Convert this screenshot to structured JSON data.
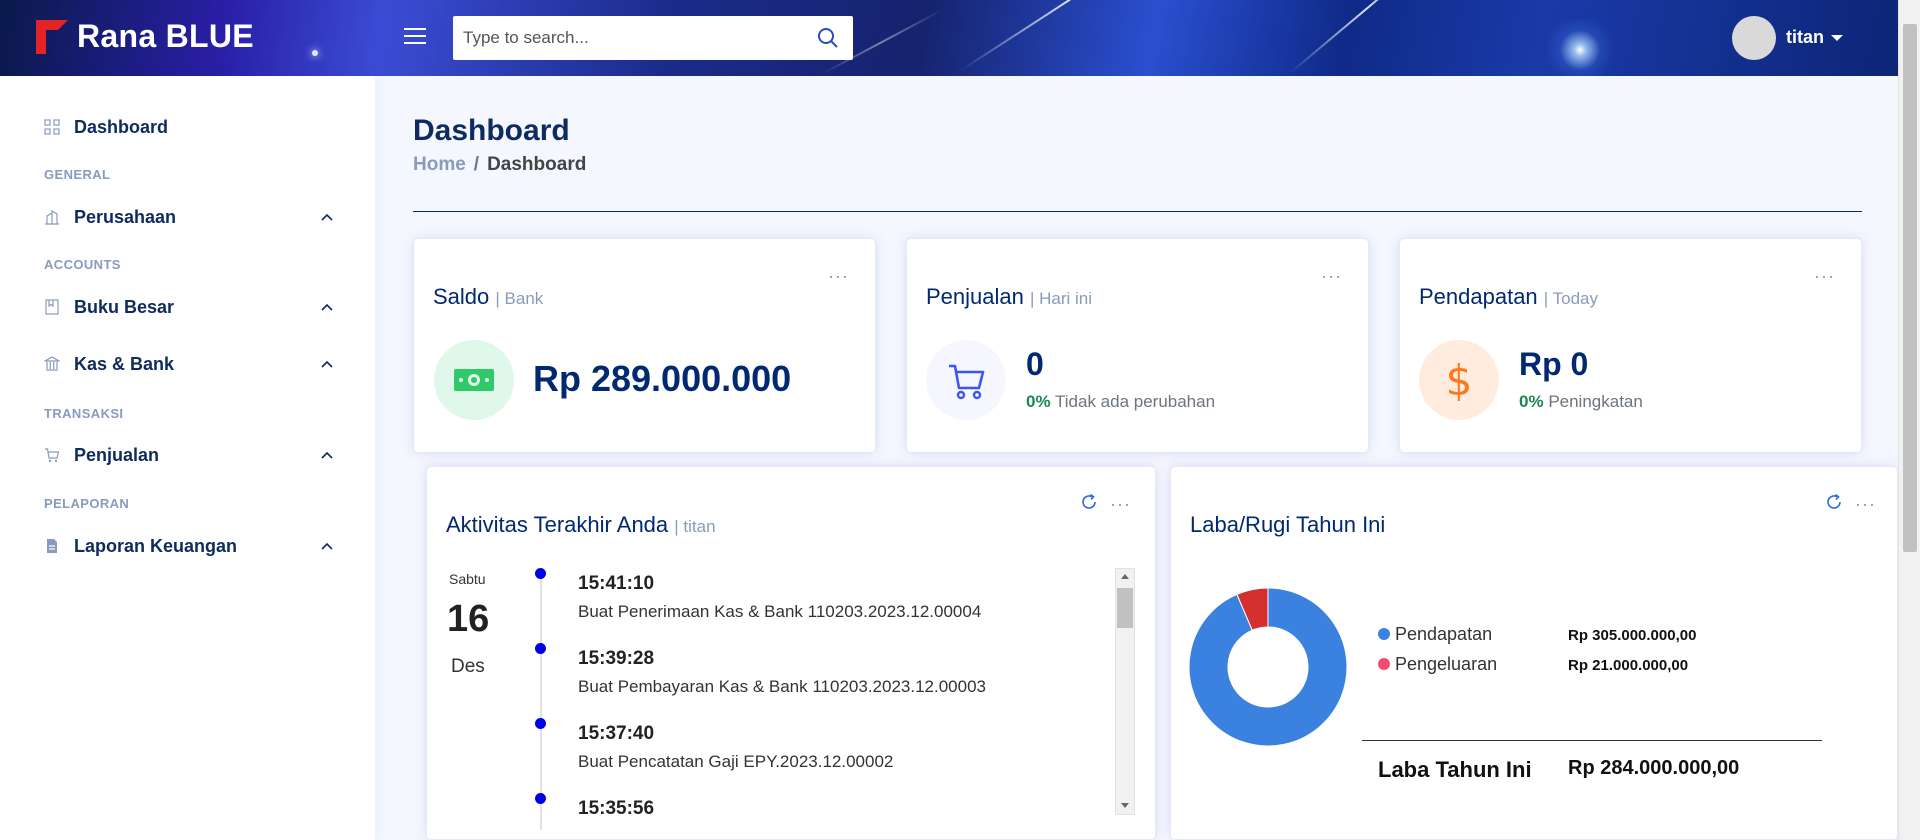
{
  "app": {
    "name": "Rana BLUE"
  },
  "header": {
    "search_placeholder": "Type to search...",
    "user_name": "titan"
  },
  "sidebar": {
    "dashboard_label": "Dashboard",
    "sections": [
      {
        "heading": "GENERAL",
        "items": [
          {
            "label": "Perusahaan",
            "icon": "building-icon"
          }
        ]
      },
      {
        "heading": "ACCOUNTS",
        "items": [
          {
            "label": "Buku Besar",
            "icon": "book-icon"
          },
          {
            "label": "Kas & Bank",
            "icon": "bank-icon"
          }
        ]
      },
      {
        "heading": "TRANSAKSI",
        "items": [
          {
            "label": "Penjualan",
            "icon": "cart-icon"
          }
        ]
      },
      {
        "heading": "PELAPORAN",
        "items": [
          {
            "label": "Laporan Keuangan",
            "icon": "report-icon"
          }
        ]
      }
    ]
  },
  "page": {
    "title": "Dashboard",
    "breadcrumb": {
      "home": "Home",
      "separator": "/",
      "current": "Dashboard"
    }
  },
  "cards": {
    "saldo": {
      "title": "Saldo",
      "subtitle": "| Bank",
      "value": "Rp 289.000.000"
    },
    "penjualan": {
      "title": "Penjualan",
      "subtitle": "| Hari ini",
      "value": "0",
      "pct": "0%",
      "note": "Tidak ada perubahan"
    },
    "pendapatan": {
      "title": "Pendapatan",
      "subtitle": "| Today",
      "value": "Rp 0",
      "pct": "0%",
      "note": "Peningkatan"
    },
    "dots": "···"
  },
  "activity": {
    "title": "Aktivitas Terakhir Anda",
    "subtitle": "| titan",
    "day_name": "Sabtu",
    "day_number": "16",
    "month": "Des",
    "items": [
      {
        "time": "15:41:10",
        "desc": "Buat Penerimaan Kas & Bank 110203.2023.12.00004"
      },
      {
        "time": "15:39:28",
        "desc": "Buat Pembayaran Kas & Bank 110203.2023.12.00003"
      },
      {
        "time": "15:37:40",
        "desc": "Buat Pencatatan Gaji EPY.2023.12.00002"
      },
      {
        "time": "15:35:56",
        "desc": ""
      }
    ]
  },
  "profit": {
    "title": "Laba/Rugi Tahun Ini",
    "legend": [
      {
        "label": "Pendapatan",
        "value": "Rp 305.000.000,00",
        "color": "#3b82e0"
      },
      {
        "label": "Pengeluaran",
        "value": "Rp 21.000.000,00",
        "color": "#ee4d6e"
      }
    ],
    "total_label": "Laba Tahun Ini",
    "total_value": "Rp 284.000.000,00"
  },
  "chart_data": {
    "type": "pie",
    "categories": [
      "Pendapatan",
      "Pengeluaran"
    ],
    "values": [
      305000000,
      21000000
    ],
    "colors": [
      "#3b82e0",
      "#d62f2f"
    ],
    "donut": true
  }
}
